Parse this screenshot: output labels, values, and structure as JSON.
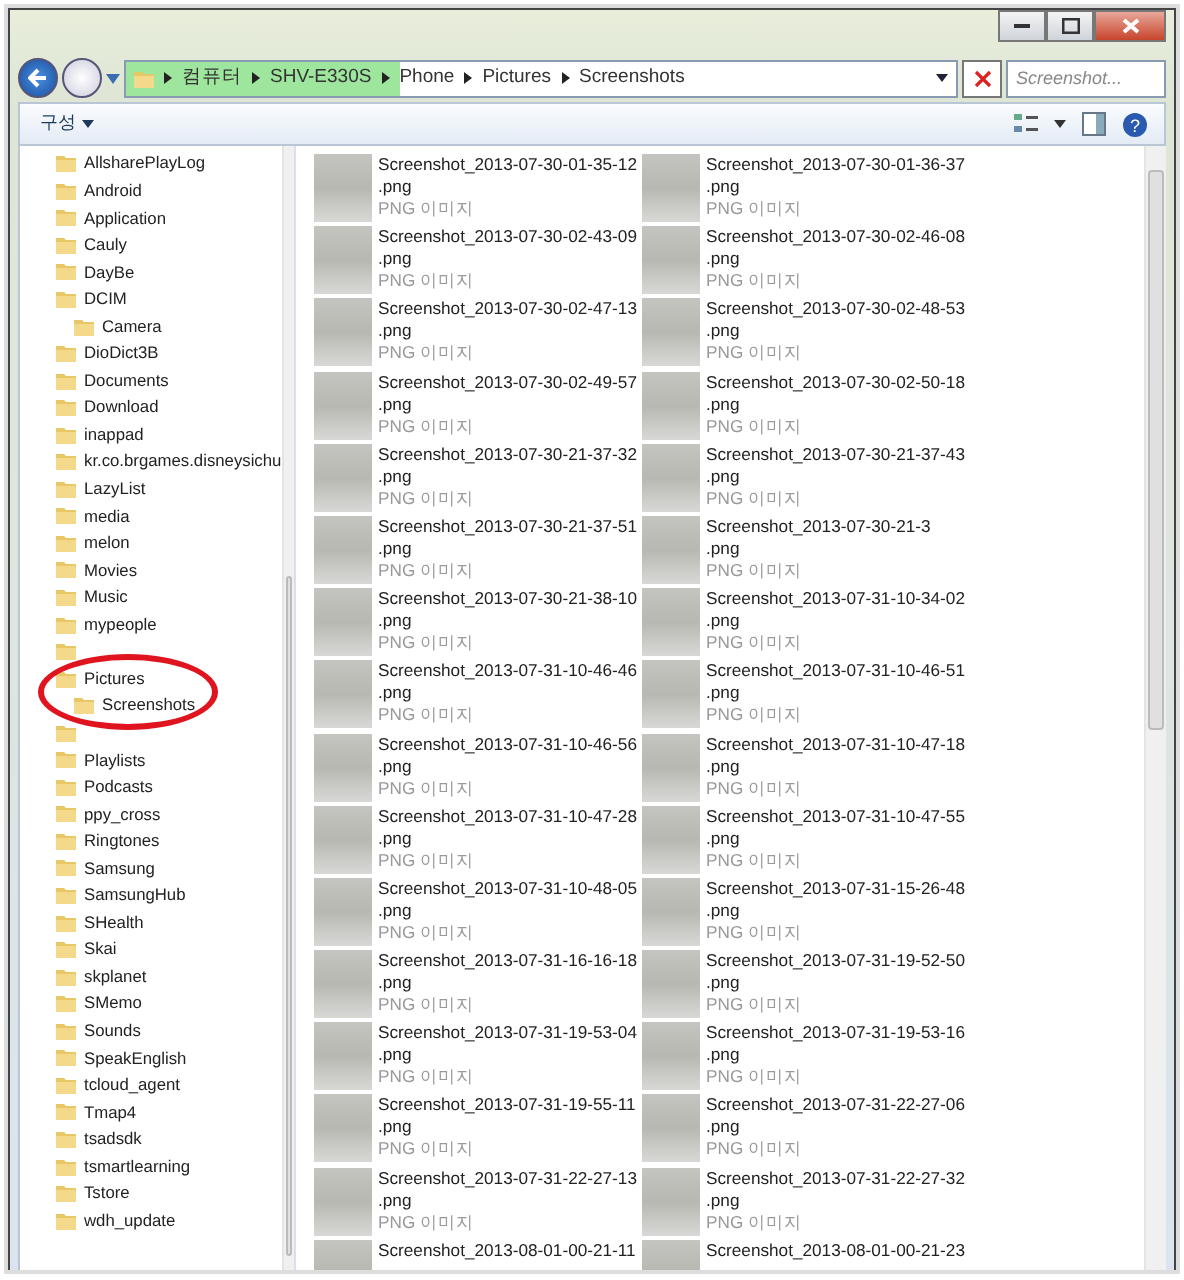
{
  "address_bar": {
    "crumbs": [
      "컴퓨터",
      "SHV-E330S",
      "Phone",
      "Pictures",
      "Screenshots"
    ],
    "level": 0.33
  },
  "search": {
    "placeholder": "Screenshot..."
  },
  "toolbar": {
    "organize": "구성",
    "help": "?"
  },
  "sidebar": {
    "items": [
      {
        "kind": "folder",
        "label": "AllsharePlayLog"
      },
      {
        "kind": "folder",
        "label": "Android"
      },
      {
        "kind": "folder",
        "label": "Application"
      },
      {
        "kind": "folder",
        "label": "Cauly"
      },
      {
        "kind": "folder",
        "label": "DayBe"
      },
      {
        "kind": "folder",
        "label": "DCIM",
        "children": [
          {
            "kind": "folder",
            "label": "Camera"
          }
        ]
      },
      {
        "kind": "folder",
        "label": "DioDict3B"
      },
      {
        "kind": "folder",
        "label": "Documents"
      },
      {
        "kind": "folder",
        "label": "Download"
      },
      {
        "kind": "folder",
        "label": "inappad"
      },
      {
        "kind": "folder",
        "label": "kr.co.brgames.disneysichu"
      },
      {
        "kind": "folder",
        "label": "LazyList"
      },
      {
        "kind": "folder",
        "label": "media"
      },
      {
        "kind": "folder",
        "label": "melon"
      },
      {
        "kind": "folder",
        "label": "Movies"
      },
      {
        "kind": "folder",
        "label": "Music"
      },
      {
        "kind": "folder",
        "label": "mypeople"
      },
      {
        "kind": "obscured"
      },
      {
        "kind": "folder",
        "label": "Pictures",
        "children": [
          {
            "kind": "folder",
            "label": "Screenshots"
          }
        ]
      },
      {
        "kind": "obscured"
      },
      {
        "kind": "folder",
        "label": "Playlists"
      },
      {
        "kind": "folder",
        "label": "Podcasts"
      },
      {
        "kind": "folder",
        "label": "ppy_cross"
      },
      {
        "kind": "folder",
        "label": "Ringtones"
      },
      {
        "kind": "folder",
        "label": "Samsung"
      },
      {
        "kind": "folder",
        "label": "SamsungHub"
      },
      {
        "kind": "folder",
        "label": "SHealth"
      },
      {
        "kind": "folder",
        "label": "Skai"
      },
      {
        "kind": "folder",
        "label": "skplanet"
      },
      {
        "kind": "folder",
        "label": "SMemo"
      },
      {
        "kind": "folder",
        "label": "Sounds"
      },
      {
        "kind": "folder",
        "label": "SpeakEnglish"
      },
      {
        "kind": "folder",
        "label": "tcloud_agent"
      },
      {
        "kind": "folder",
        "label": "Tmap4"
      },
      {
        "kind": "folder",
        "label": "tsadsdk"
      },
      {
        "kind": "folder",
        "label": "tsmartlearning"
      },
      {
        "kind": "folder",
        "label": "Tstore"
      },
      {
        "kind": "folder",
        "label": "wdh_update"
      }
    ]
  },
  "files": [
    {
      "name": "Screenshot_2013-07-30-01-35-12",
      "ext": ".png",
      "type": "PNG 이미지"
    },
    {
      "name": "Screenshot_2013-07-30-01-36-37",
      "ext": ".png",
      "type": "PNG 이미지"
    },
    {
      "name": "Screenshot_2013-07-30-02-43-09",
      "ext": ".png",
      "type": "PNG 이미지"
    },
    {
      "name": "Screenshot_2013-07-30-02-46-08",
      "ext": ".png",
      "type": "PNG 이미지"
    },
    {
      "name": "Screenshot_2013-07-30-02-47-13",
      "ext": ".png",
      "type": "PNG 이미지"
    },
    {
      "name": "Screenshot_2013-07-30-02-48-53",
      "ext": ".png",
      "type": "PNG 이미지"
    },
    {
      "name": "Screenshot_2013-07-30-02-49-57",
      "ext": ".png",
      "type": "PNG 이미지"
    },
    {
      "name": "Screenshot_2013-07-30-02-50-18",
      "ext": ".png",
      "type": "PNG 이미지"
    },
    {
      "name": "Screenshot_2013-07-30-21-37-32",
      "ext": ".png",
      "type": "PNG 이미지"
    },
    {
      "name": "Screenshot_2013-07-30-21-37-43",
      "ext": ".png",
      "type": "PNG 이미지"
    },
    {
      "name": "Screenshot_2013-07-30-21-37-51",
      "ext": ".png",
      "type": "PNG 이미지"
    },
    {
      "name": "Screenshot_2013-07-30-21-3",
      "ext": ".png",
      "type": "PNG 이미지"
    },
    {
      "name": "Screenshot_2013-07-30-21-38-10",
      "ext": ".png",
      "type": "PNG 이미지"
    },
    {
      "name": "Screenshot_2013-07-31-10-34-02",
      "ext": ".png",
      "type": "PNG 이미지"
    },
    {
      "name": "Screenshot_2013-07-31-10-46-46",
      "ext": ".png",
      "type": "PNG 이미지"
    },
    {
      "name": "Screenshot_2013-07-31-10-46-51",
      "ext": ".png",
      "type": "PNG 이미지"
    },
    {
      "name": "Screenshot_2013-07-31-10-46-56",
      "ext": ".png",
      "type": "PNG 이미지"
    },
    {
      "name": "Screenshot_2013-07-31-10-47-18",
      "ext": ".png",
      "type": "PNG 이미지"
    },
    {
      "name": "Screenshot_2013-07-31-10-47-28",
      "ext": ".png",
      "type": "PNG 이미지"
    },
    {
      "name": "Screenshot_2013-07-31-10-47-55",
      "ext": ".png",
      "type": "PNG 이미지"
    },
    {
      "name": "Screenshot_2013-07-31-10-48-05",
      "ext": ".png",
      "type": "PNG 이미지"
    },
    {
      "name": "Screenshot_2013-07-31-15-26-48",
      "ext": ".png",
      "type": "PNG 이미지"
    },
    {
      "name": "Screenshot_2013-07-31-16-16-18",
      "ext": ".png",
      "type": "PNG 이미지"
    },
    {
      "name": "Screenshot_2013-07-31-19-52-50",
      "ext": ".png",
      "type": "PNG 이미지"
    },
    {
      "name": "Screenshot_2013-07-31-19-53-04",
      "ext": ".png",
      "type": "PNG 이미지"
    },
    {
      "name": "Screenshot_2013-07-31-19-53-16",
      "ext": ".png",
      "type": "PNG 이미지"
    },
    {
      "name": "Screenshot_2013-07-31-19-55-11",
      "ext": ".png",
      "type": "PNG 이미지"
    },
    {
      "name": "Screenshot_2013-07-31-22-27-06",
      "ext": ".png",
      "type": "PNG 이미지"
    },
    {
      "name": "Screenshot_2013-07-31-22-27-13",
      "ext": ".png",
      "type": "PNG 이미지"
    },
    {
      "name": "Screenshot_2013-07-31-22-27-32",
      "ext": ".png",
      "type": "PNG 이미지"
    },
    {
      "name": "Screenshot_2013-08-01-00-21-11"
    },
    {
      "name": "Screenshot_2013-08-01-00-21-23"
    }
  ]
}
